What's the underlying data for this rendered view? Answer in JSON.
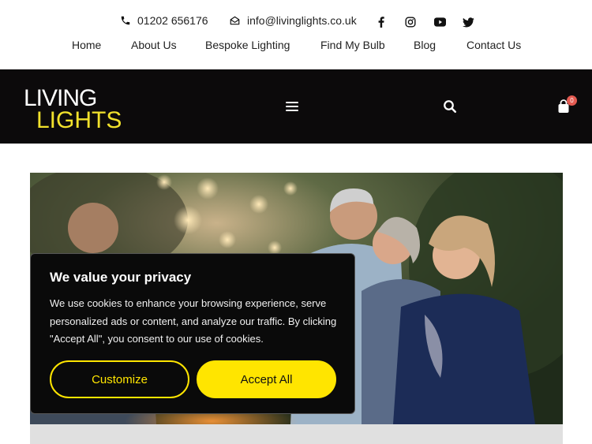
{
  "contact": {
    "phone": "01202 656176",
    "email": "info@livinglights.co.uk"
  },
  "social": [
    "facebook-icon",
    "instagram-icon",
    "youtube-icon",
    "twitter-icon"
  ],
  "nav": [
    {
      "label": "Home"
    },
    {
      "label": "About Us"
    },
    {
      "label": "Bespoke Lighting"
    },
    {
      "label": "Find My Bulb"
    },
    {
      "label": "Blog"
    },
    {
      "label": "Contact Us"
    }
  ],
  "header": {
    "logo_line1": "LIVING",
    "logo_line2": "LIGHTS",
    "cart_count": "0",
    "brand_color": "#f1e12c",
    "background": "#0c0a0b"
  },
  "cookie": {
    "title": "We value your privacy",
    "body": "We use cookies to enhance your browsing experience, serve personalized ads or content, and analyze our traffic. By clicking \"Accept All\", you consent to our use of cookies.",
    "customize_label": "Customize",
    "accept_label": "Accept All",
    "accent": "#ffe500"
  }
}
